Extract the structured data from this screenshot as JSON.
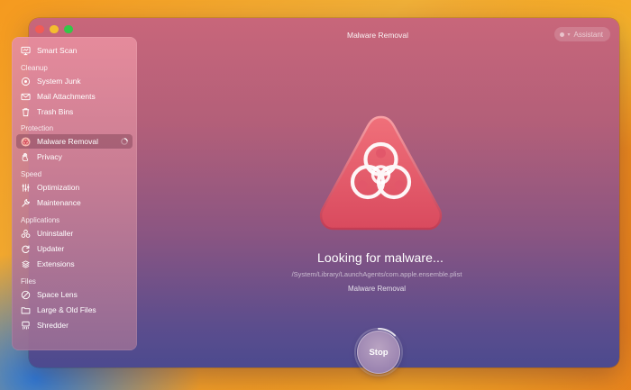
{
  "window": {
    "title": "Malware Removal",
    "assistant_label": "Assistant"
  },
  "sidebar": {
    "smart_scan": "Smart Scan",
    "sections": {
      "cleanup": "Cleanup",
      "protection": "Protection",
      "speed": "Speed",
      "applications": "Applications",
      "files": "Files"
    },
    "items": {
      "system_junk": "System Junk",
      "mail_attachments": "Mail Attachments",
      "trash_bins": "Trash Bins",
      "malware_removal": "Malware Removal",
      "privacy": "Privacy",
      "optimization": "Optimization",
      "maintenance": "Maintenance",
      "uninstaller": "Uninstaller",
      "updater": "Updater",
      "extensions": "Extensions",
      "space_lens": "Space Lens",
      "large_old_files": "Large & Old Files",
      "shredder": "Shredder"
    },
    "active_item": "malware_removal"
  },
  "main": {
    "status_title": "Looking for malware...",
    "current_path": "/System/Library/LaunchAgents/com.apple.ensemble.plist",
    "module_label": "Malware Removal",
    "stop_label": "Stop",
    "hero_icon": "biohazard-icon"
  },
  "colors": {
    "hero_red": "#ee5a66",
    "window_top": "#c8667a",
    "window_bottom": "#4c4a8f"
  }
}
